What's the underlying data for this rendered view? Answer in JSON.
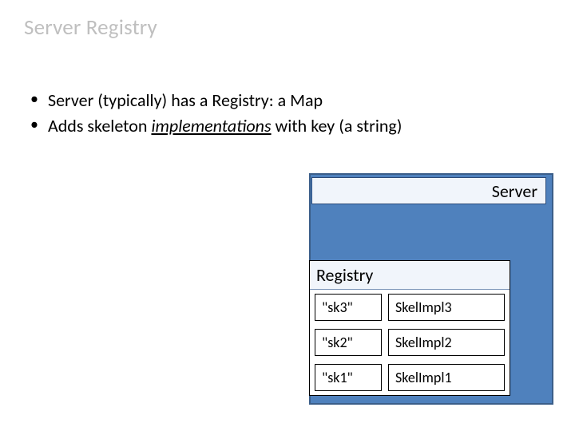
{
  "title": "Server Registry",
  "bullets": {
    "b1_pre": "Server (typically) has a Registry: a Map",
    "b2_pre": "Adds skeleton ",
    "b2_ital": "implementations",
    "b2_post": " with key (a string)"
  },
  "server": {
    "label": "Server"
  },
  "registry": {
    "header": "Registry",
    "rows": [
      {
        "key": "\"sk3\"",
        "value": "SkelImpl3"
      },
      {
        "key": "\"sk2\"",
        "value": "SkelImpl2"
      },
      {
        "key": "\"sk1\"",
        "value": "SkelImpl1"
      }
    ]
  }
}
